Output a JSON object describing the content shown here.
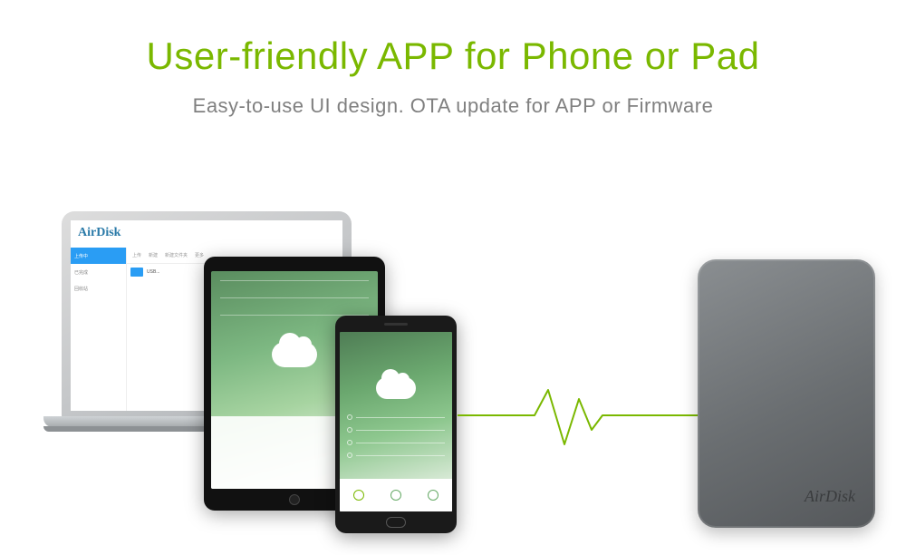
{
  "title": "User-friendly APP for Phone or Pad",
  "subtitle": "Easy-to-use UI design. OTA update for APP or Firmware",
  "laptop": {
    "brand": "AirDisk",
    "sidebar": [
      "上传中",
      "已完成",
      "回收站"
    ],
    "toolbar": [
      "上传",
      "新建",
      "新建文件夹",
      "更多"
    ],
    "folder": "USB..."
  },
  "device": {
    "logo": "AirDisk"
  },
  "colors": {
    "accent": "#7ab800",
    "subtitle": "#808080",
    "laptop_brand": "#2a7aa8"
  }
}
